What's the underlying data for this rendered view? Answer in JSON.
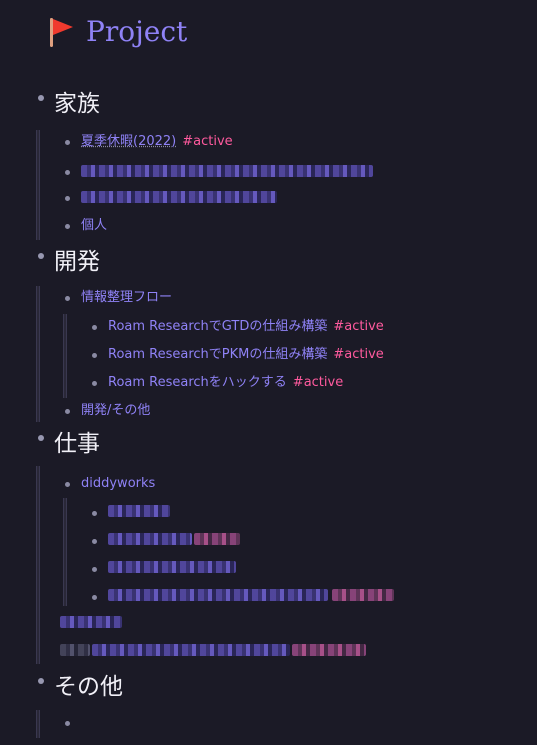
{
  "page": {
    "title": "Project",
    "icon": "red-flag-icon"
  },
  "sections": [
    {
      "heading": "家族",
      "items": [
        {
          "label": "夏季休暇(2022)",
          "tag": "#active"
        },
        {
          "label": "個人"
        }
      ]
    },
    {
      "heading": "開発",
      "items": [
        {
          "label": "情報整理フロー"
        },
        {
          "label": "Roam ResearchでGTDの仕組み構築",
          "tag": "#active"
        },
        {
          "label": "Roam ResearchでPKMの仕組み構築",
          "tag": "#active"
        },
        {
          "label": "Roam Researchをハックする",
          "tag": "#active"
        },
        {
          "label": "開発/その他"
        }
      ]
    },
    {
      "heading": "仕事",
      "items": [
        {
          "label": "diddyworks"
        }
      ]
    },
    {
      "heading": "その他",
      "items": []
    }
  ],
  "colors": {
    "background": "#1b1a26",
    "link": "#8f82f6",
    "tag": "#ff5a9e",
    "heading": "#f1f0f7"
  }
}
